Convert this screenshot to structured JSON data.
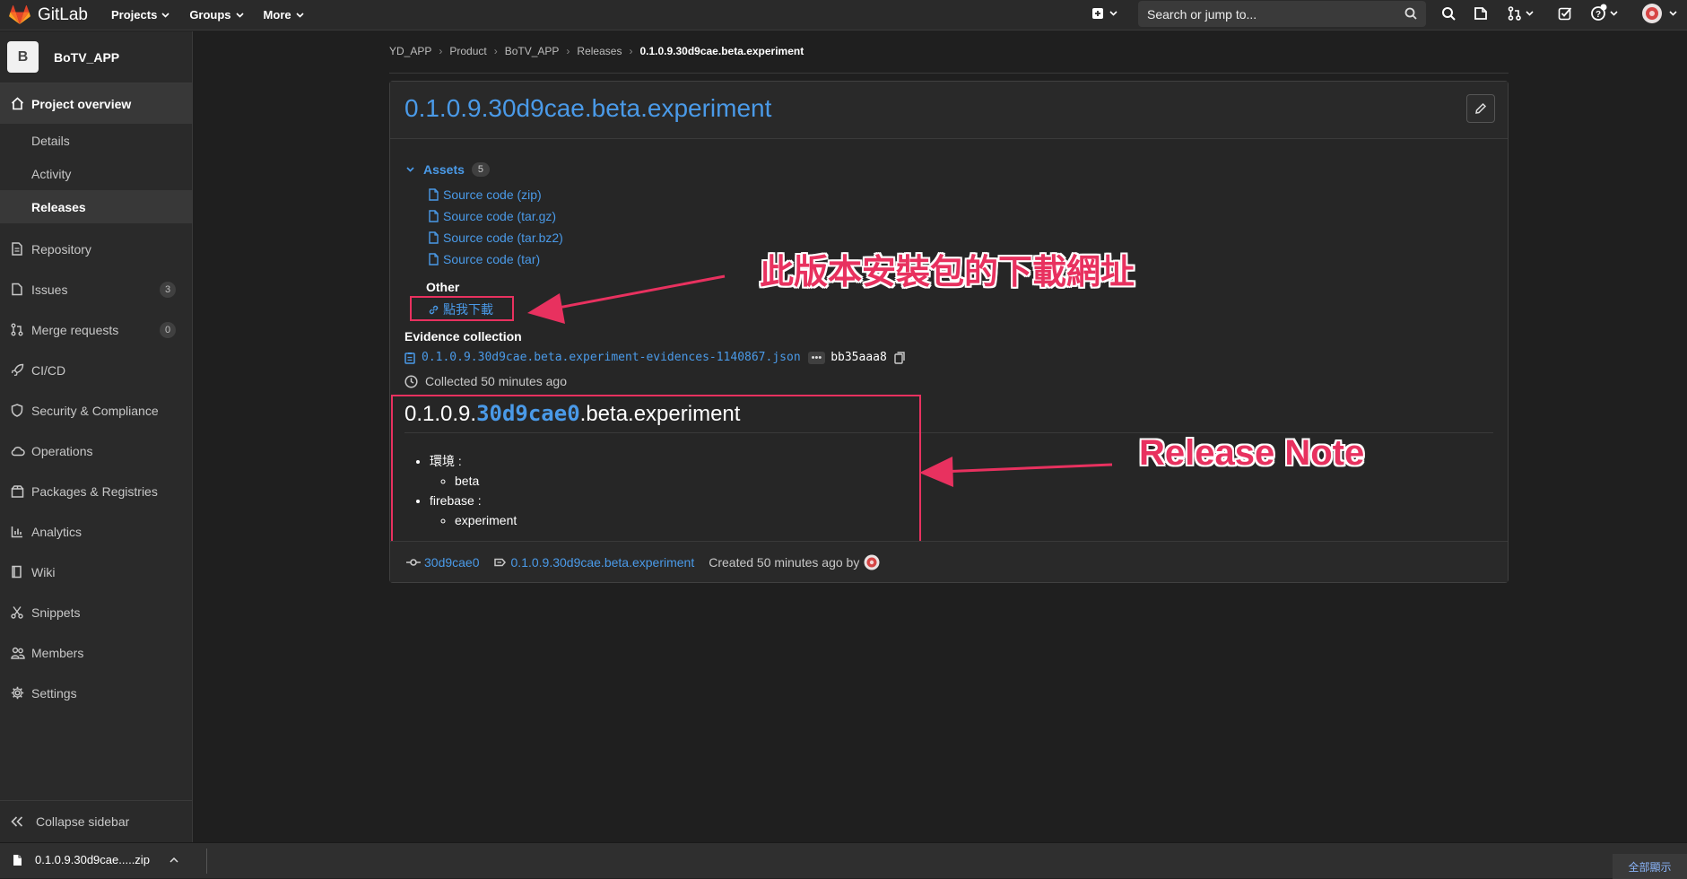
{
  "navbar": {
    "brand": "GitLab",
    "menu": [
      "Projects",
      "Groups",
      "More"
    ],
    "search_placeholder": "Search or jump to..."
  },
  "sidebar": {
    "project_initial": "B",
    "project_name": "BoTV_APP",
    "overview_label": "Project overview",
    "overview_items": [
      "Details",
      "Activity",
      "Releases"
    ],
    "items": [
      {
        "label": "Repository",
        "icon": "doc-icon"
      },
      {
        "label": "Issues",
        "icon": "issues-icon",
        "count": "3"
      },
      {
        "label": "Merge requests",
        "icon": "merge-request-icon",
        "count": "0"
      },
      {
        "label": "CI/CD",
        "icon": "rocket-icon"
      },
      {
        "label": "Security & Compliance",
        "icon": "shield-icon"
      },
      {
        "label": "Operations",
        "icon": "cloud-icon"
      },
      {
        "label": "Packages & Registries",
        "icon": "package-icon"
      },
      {
        "label": "Analytics",
        "icon": "chart-icon"
      },
      {
        "label": "Wiki",
        "icon": "book-icon"
      },
      {
        "label": "Snippets",
        "icon": "scissors-icon"
      },
      {
        "label": "Members",
        "icon": "users-icon"
      },
      {
        "label": "Settings",
        "icon": "gear-icon"
      }
    ],
    "collapse_label": "Collapse sidebar"
  },
  "breadcrumb": [
    "YD_APP",
    "Product",
    "BoTV_APP",
    "Releases",
    "0.1.0.9.30d9cae.beta.experiment"
  ],
  "release": {
    "title": "0.1.0.9.30d9cae.beta.experiment",
    "assets_label": "Assets",
    "assets_count": "5",
    "sources": [
      "Source code (zip)",
      "Source code (tar.gz)",
      "Source code (tar.bz2)",
      "Source code (tar)"
    ],
    "other_label": "Other",
    "other_link": "點我下載",
    "evidence_label": "Evidence collection",
    "evidence_file": "0.1.0.9.30d9cae.beta.experiment-evidences-1140867.json",
    "evidence_ellipsis": "•••",
    "evidence_sha": "bb35aaa8",
    "collected": "Collected 50 minutes ago",
    "notes": {
      "title_pre": "0.1.0.9.",
      "title_code": "30d9cae0",
      "title_post": ".beta.experiment",
      "items": [
        {
          "label": "環境 :",
          "sub": "beta"
        },
        {
          "label": "firebase :",
          "sub": "experiment"
        }
      ]
    },
    "footer": {
      "commit": "30d9cae0",
      "tag": "0.1.0.9.30d9cae.beta.experiment",
      "created": "Created 50 minutes ago by"
    }
  },
  "annotations": {
    "download_note": "此版本安裝包的下載網址",
    "release_note": "Release Note",
    "color": "#e8315f"
  },
  "download_bar": {
    "file": "0.1.0.9.30d9cae.....zip",
    "show_all": "全部顯示"
  },
  "colors": {
    "link": "#4a9ae8",
    "background": "#1f1f1f",
    "sidebar": "#2a2a2a"
  }
}
